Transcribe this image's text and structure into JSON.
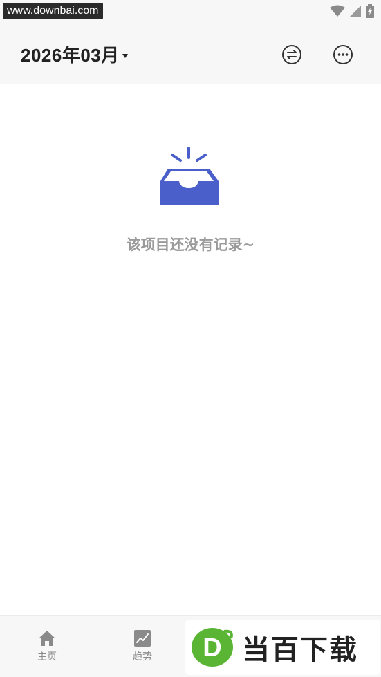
{
  "status_bar": {
    "site_watermark": "www.downbai.com",
    "icons": [
      "wifi-icon",
      "cell-signal-icon",
      "battery-charging-icon"
    ]
  },
  "header": {
    "month_label": "2026年03月",
    "icons": [
      "caret-down-icon",
      "swap-icon",
      "more-icon"
    ]
  },
  "empty_state": {
    "icon": "inbox-icon",
    "icon_color": "#4a5fc9",
    "message": "该项目还没有记录~"
  },
  "bottom_nav": {
    "items": [
      {
        "label": "主页",
        "icon": "home-icon"
      },
      {
        "label": "趋势",
        "icon": "trend-icon"
      }
    ]
  },
  "brand_watermark": {
    "logo_letter": "D",
    "text": "当百下载",
    "logo_color": "#5ab534"
  }
}
